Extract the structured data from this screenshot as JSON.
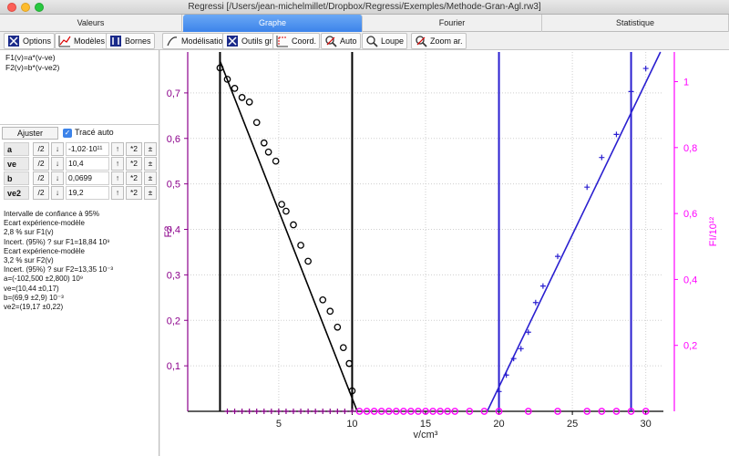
{
  "window": {
    "title": "Regressi [/Users/jean-michelmillet/Dropbox/Regressi/Exemples/Methode-Gran-Agl.rw3]"
  },
  "tabs": [
    {
      "label": "Valeurs",
      "active": false
    },
    {
      "label": "Graphe",
      "active": true
    },
    {
      "label": "Fourier",
      "active": false
    },
    {
      "label": "Statistique",
      "active": false
    }
  ],
  "left_toolbar": {
    "options": "Options",
    "modeles": "Modèles",
    "bornes": "Bornes"
  },
  "graph_toolbar": {
    "modelisation": "Modélisation",
    "outils": "Outils gr.",
    "coord": "Coord.",
    "auto": "Auto",
    "loupe": "Loupe",
    "zoom": "Zoom ar."
  },
  "models": {
    "line1": "F1(v)=a*(v-ve)",
    "line2": "F2(v)=b*(v-ve2)"
  },
  "fit": {
    "ajuster": "Ajuster",
    "trace_auto": "Tracé auto",
    "trace_auto_checked": true
  },
  "param_buttons": {
    "div2": "/2",
    "down": "↓",
    "up": "↑",
    "mul2": "*2",
    "pm": "±"
  },
  "params": [
    {
      "name": "a",
      "value": "-1,02·10¹¹"
    },
    {
      "name": "ve",
      "value": "10,4"
    },
    {
      "name": "b",
      "value": "0,0699"
    },
    {
      "name": "ve2",
      "value": "19,2"
    }
  ],
  "results": [
    "Intervalle de confiance à 95%",
    "Ecart expérience-modèle",
    "  2,8 % sur F1(v)",
    "Incert. (95%) ? sur F1=18,84 10⁹",
    "Ecart expérience-modèle",
    "  3,2 % sur F2(v)",
    "Incert. (95%) ? sur F2=13,35 10⁻³",
    "a=(-102,500 ±2,800) 10⁹",
    "ve=(10,44 ±0,17)",
    "b=(69,9 ±2,9) 10⁻³",
    "ve2=(19,17 ±0,22)"
  ],
  "colors": {
    "left_axis": "#8b008b",
    "right_axis": "#ff00ff",
    "model_blue": "#2a1fd0",
    "black": "#000000",
    "tab_active": "#3c83ea"
  },
  "chart_data": {
    "type": "scatter",
    "xlabel": "v/cm³",
    "ylabel_left": "F2",
    "ylabel_right": "FI/10¹²",
    "xlim": [
      -1.2,
      31.2
    ],
    "ylim_left": [
      0,
      0.79
    ],
    "ylim_right": [
      0,
      1.09
    ],
    "xticks": [
      5,
      10,
      15,
      20,
      25,
      30
    ],
    "yticks_left": [
      "0,1",
      "0,2",
      "0,3",
      "0,4",
      "0,5",
      "0,6",
      "0,7"
    ],
    "yticks_left_values": [
      0.1,
      0.2,
      0.3,
      0.4,
      0.5,
      0.6,
      0.7
    ],
    "yticks_right": [
      "0,2",
      "0,4",
      "0,6",
      "0,8",
      "1"
    ],
    "yticks_right_values": [
      0.2,
      0.4,
      0.6,
      0.8,
      1.0
    ],
    "grid": true,
    "vertical_lines": [
      {
        "x": 1.0,
        "color": "#000000"
      },
      {
        "x": 10.0,
        "color": "#000000"
      },
      {
        "x": 20.0,
        "color": "#2a1fd0"
      },
      {
        "x": 29.0,
        "color": "#2a1fd0"
      }
    ],
    "series": [
      {
        "marker": "circle",
        "color": "#000000",
        "axis": "left",
        "x": [
          1.0,
          1.5,
          2.0,
          2.5,
          3.0,
          3.5,
          4.0,
          4.3,
          4.8,
          5.2,
          5.5,
          6.0,
          6.5,
          7.0,
          8.0,
          8.5,
          9.0,
          9.4,
          9.8,
          10.0
        ],
        "y": [
          0.755,
          0.73,
          0.71,
          0.69,
          0.68,
          0.635,
          0.59,
          0.57,
          0.55,
          0.455,
          0.44,
          0.41,
          0.365,
          0.33,
          0.245,
          0.22,
          0.185,
          0.14,
          0.105,
          0.045
        ]
      },
      {
        "marker": "circle",
        "color": "#ff00ff",
        "axis": "left",
        "x": [
          10.5,
          11.0,
          11.5,
          12.0,
          12.5,
          13.0,
          13.5,
          14.0,
          14.5,
          15.0,
          15.5,
          16.0,
          16.5,
          17.0,
          18.0,
          19.0,
          20.0,
          22.0,
          24.0,
          26.0,
          27.0,
          28.0,
          29.0,
          30.0
        ],
        "y": [
          0,
          0,
          0,
          0,
          0,
          0,
          0,
          0,
          0,
          0,
          0,
          0,
          0,
          0,
          0,
          0,
          0,
          0,
          0,
          0,
          0,
          0,
          0,
          0
        ]
      },
      {
        "marker": "plus",
        "color": "#8b008b",
        "axis": "right",
        "x": [
          1.5,
          2.0,
          2.5,
          3.0,
          3.5,
          4.0,
          4.5,
          5.0,
          5.5,
          6.0,
          6.5,
          7.0,
          7.5,
          8.0,
          8.5,
          9.0,
          9.5,
          10.0
        ],
        "y": [
          0,
          0,
          0,
          0,
          0,
          0,
          0,
          0,
          0,
          0,
          0,
          0,
          0,
          0,
          0,
          0,
          0,
          0
        ]
      },
      {
        "marker": "plus",
        "color": "#2a1fd0",
        "axis": "right",
        "x": [
          20.0,
          20.5,
          21.0,
          21.5,
          22.0,
          22.5,
          23.0,
          24.0,
          26.0,
          27.0,
          28.0,
          29.0,
          30.0
        ],
        "y": [
          0.06,
          0.11,
          0.16,
          0.19,
          0.24,
          0.33,
          0.38,
          0.47,
          0.68,
          0.77,
          0.84,
          0.97,
          1.04
        ]
      }
    ],
    "models": [
      {
        "name": "F1",
        "axis": "left",
        "color": "#000000",
        "x": [
          1.0,
          10.35
        ],
        "y": [
          0.77,
          0.0
        ]
      },
      {
        "name": "F2",
        "axis": "right",
        "color": "#2a1fd0",
        "x": [
          19.2,
          31.0
        ],
        "y": [
          0.0,
          1.09
        ]
      }
    ]
  }
}
